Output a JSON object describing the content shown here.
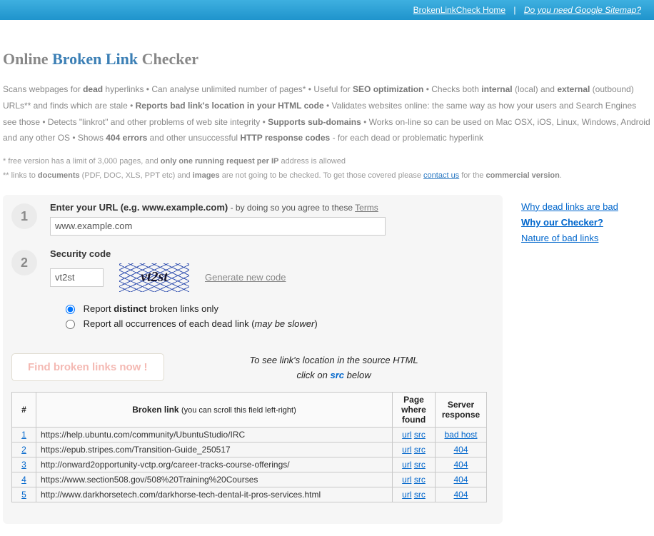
{
  "topbar": {
    "home": "BrokenLinkCheck Home",
    "sitemap": "Do you need Google Sitemap?"
  },
  "title": {
    "pre": "Online ",
    "mid": "Broken Link",
    "post": " Checker"
  },
  "desc_parts": {
    "p1a": "Scans webpages for ",
    "b1": "dead",
    "p1b": " hyperlinks • Can analyse unlimited number of pages* • Useful for ",
    "b2": "SEO optimization",
    "p1c": " • Checks both ",
    "b3": "internal",
    "p1d": " (local) and ",
    "b4": "external",
    "p1e": " (outbound) URLs** and finds which are stale • ",
    "b5": "Reports bad link's location in your HTML code",
    "p1f": " • Validates websites online: the same way as how your users and Search Engines see those • Detects \"linkrot\" and other problems of web site integrity • ",
    "b6": "Supports sub-domains",
    "p1g": " • Works on-line so can be used on Mac OSX, iOS, Linux, Windows, Android and any other OS • Shows ",
    "b7": "404 errors",
    "p1h": " and other unsuccessful ",
    "b8": "HTTP response codes",
    "p1i": " - for each dead or problematic hyperlink"
  },
  "footnote1": {
    "a": "*  free version has a limit of 3,000 pages, and ",
    "b": "only one running request per IP",
    "c": " address is allowed"
  },
  "footnote2": {
    "a": "** links to ",
    "b": "documents",
    "c": " (PDF, DOC, XLS, PPT etc) and ",
    "d": "images",
    "e": " are not going to be checked. To get those covered please ",
    "link": "contact us",
    "f": " for the ",
    "g": "commercial version",
    "h": "."
  },
  "form": {
    "step1_num": "1",
    "step1_label_a": "Enter your URL ",
    "step1_label_b": "(e.g. www.example.com)",
    "step1_label_c": " - by doing so you agree to these ",
    "step1_terms": "Terms",
    "url_value": "www.example.com",
    "step2_num": "2",
    "step2_label": "Security code",
    "code_value": "vt2st",
    "captcha_text": "vt2st",
    "gen_new": "Generate new code",
    "radio1_a": "Report ",
    "radio1_b": "distinct",
    "radio1_c": " broken links only",
    "radio2_a": "Report all occurrences of each dead link (",
    "radio2_i": "may be slower",
    "radio2_b": ")",
    "button": "Find broken links now !"
  },
  "side": [
    {
      "label": "Why dead links are bad",
      "bold": false
    },
    {
      "label": "Why our Checker?",
      "bold": true
    },
    {
      "label": "Nature of bad links",
      "bold": false
    }
  ],
  "hint": {
    "a": "To see link's location in the source HTML",
    "b": "click on ",
    "src": "src",
    "c": " below"
  },
  "headers": {
    "num": "#",
    "link": "Broken link",
    "link_sub": "(you can scroll this field left-right)",
    "page": "Page where found",
    "resp": "Server response"
  },
  "links": {
    "url": "url",
    "src": "src"
  },
  "rows": [
    {
      "n": "1",
      "url": "https://help.ubuntu.com/community/UbuntuStudio/IRC",
      "resp": "bad host"
    },
    {
      "n": "2",
      "url": "https://epub.stripes.com/Transition-Guide_250517",
      "resp": "404"
    },
    {
      "n": "3",
      "url": "http://onward2opportunity-vctp.org/career-tracks-course-offerings/",
      "resp": "404"
    },
    {
      "n": "4",
      "url": "https://www.section508.gov/508%20Training%20Courses",
      "resp": "404"
    },
    {
      "n": "5",
      "url": "http://www.darkhorsetech.com/darkhorse-tech-dental-it-pros-services.html",
      "resp": "404"
    }
  ]
}
